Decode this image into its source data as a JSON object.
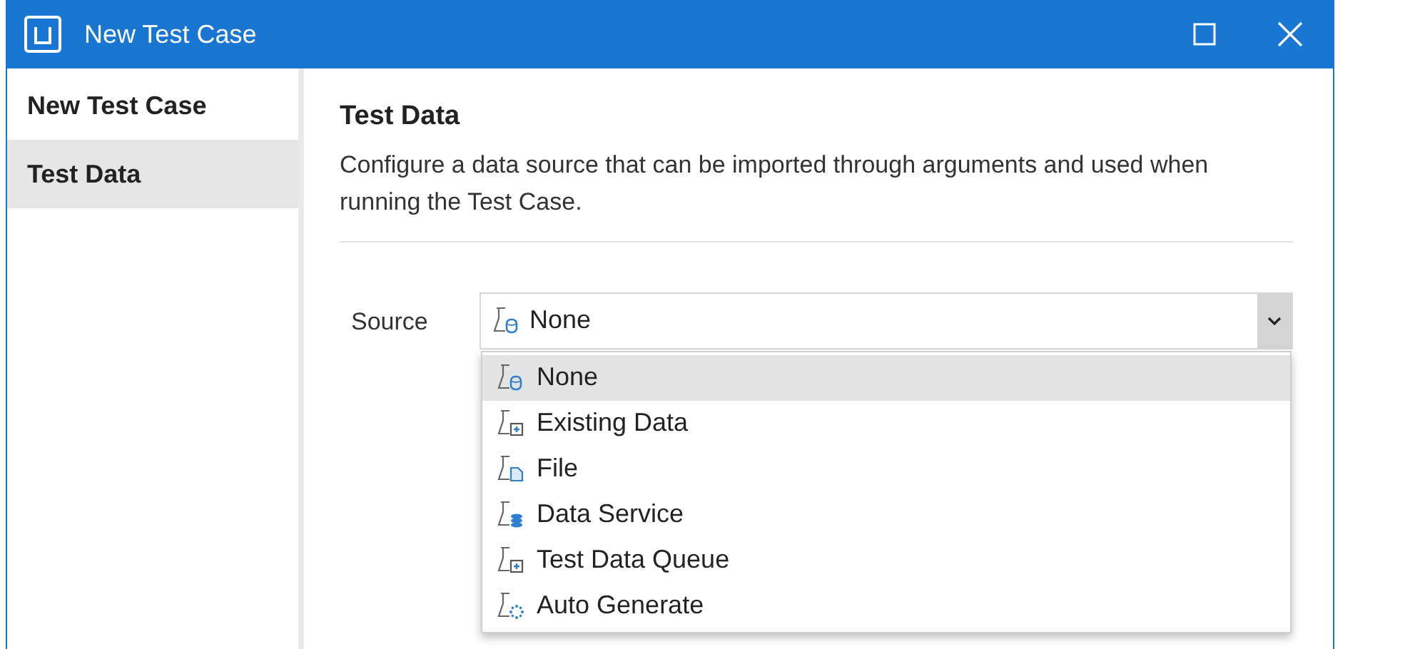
{
  "window": {
    "title": "New Test Case"
  },
  "sidebar": {
    "items": [
      {
        "label": "New Test Case",
        "selected": false
      },
      {
        "label": "Test Data",
        "selected": true
      }
    ]
  },
  "section": {
    "title": "Test Data",
    "description": "Configure a data source that can be imported through arguments and used when running the Test Case."
  },
  "source": {
    "label": "Source",
    "value": {
      "text": "None",
      "kind": "none"
    },
    "expanded": true,
    "options": [
      {
        "label": "None",
        "kind": "none",
        "selected": true
      },
      {
        "label": "Existing Data",
        "kind": "existing",
        "selected": false
      },
      {
        "label": "File",
        "kind": "file",
        "selected": false
      },
      {
        "label": "Data Service",
        "kind": "service",
        "selected": false
      },
      {
        "label": "Test Data Queue",
        "kind": "queue",
        "selected": false
      },
      {
        "label": "Auto Generate",
        "kind": "generate",
        "selected": false
      }
    ]
  }
}
